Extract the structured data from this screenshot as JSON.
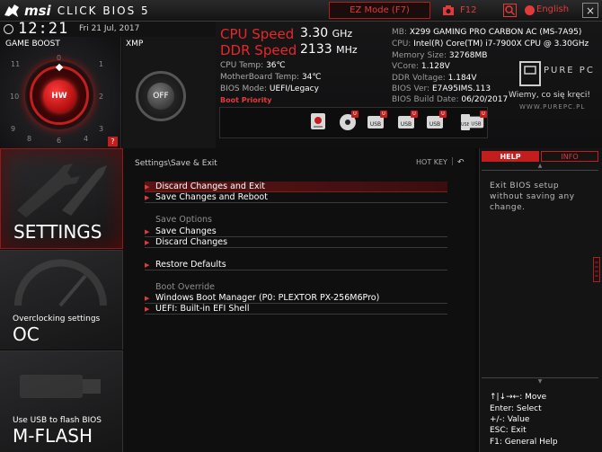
{
  "header": {
    "logo_brand": "msi",
    "logo_product": "CLICK BIOS 5",
    "ez_mode": "EZ Mode (F7)",
    "f12": "F12",
    "language": "English",
    "close": "×"
  },
  "clock": {
    "time": "12:21",
    "date": "Fri 21 Jul, 2017"
  },
  "game_boost": {
    "label": "GAME BOOST",
    "knob_label": "HW",
    "help_badge": "?",
    "dial_numbers": [
      "11",
      "0",
      "1",
      "10",
      "2",
      "9",
      "3",
      "8",
      "4",
      "6"
    ]
  },
  "xmp": {
    "label": "XMP",
    "state": "OFF"
  },
  "speeds": {
    "cpu_label": "CPU Speed",
    "cpu_value": "3.30",
    "cpu_unit": "GHz",
    "ddr_label": "DDR Speed",
    "ddr_value": "2133",
    "ddr_unit": "MHz"
  },
  "monitor": {
    "cpu_temp_label": "CPU Temp:",
    "cpu_temp": "36℃",
    "mb_temp_label": "MotherBoard Temp:",
    "mb_temp": "34℃",
    "bios_mode_label": "BIOS Mode:",
    "bios_mode": "UEFI/Legacy"
  },
  "boot_priority": {
    "label": "Boot Priority",
    "devices": [
      {
        "icon": "hdd-icon",
        "badge": ""
      },
      {
        "icon": "optical-disc-icon",
        "badge": "U"
      },
      {
        "icon": "usb-drive-icon",
        "badge": "U",
        "text": "USB"
      },
      {
        "icon": "usb-drive-icon",
        "badge": "U",
        "text": "USB"
      },
      {
        "icon": "usb-drive-icon",
        "badge": "U",
        "text": "USB"
      },
      {
        "icon": "usb-key-icon",
        "badge": "",
        "text": "USB"
      },
      {
        "icon": "usb-drive-icon",
        "badge": "U",
        "text": "USB"
      },
      {
        "icon": "network-icon",
        "badge": "U"
      }
    ]
  },
  "system": {
    "mb_label": "MB:",
    "mb": "X299 GAMING PRO CARBON AC (MS-7A95)",
    "cpu_label": "CPU:",
    "cpu": "Intel(R) Core(TM) i7-7900X CPU @ 3.30GHz",
    "mem_label": "Memory Size:",
    "mem": "32768MB",
    "vcore_label": "VCore:",
    "vcore": "1.128V",
    "ddr_v_label": "DDR Voltage:",
    "ddr_v": "1.184V",
    "bios_ver_label": "BIOS Ver:",
    "bios_ver": "E7A95IMS.113",
    "bios_date_label": "BIOS Build Date:",
    "bios_date": "06/20/2017"
  },
  "watermark": {
    "brand": "PURE PC",
    "motto": "Wiemy, co się kręci!",
    "url": "WWW.PUREPC.PL"
  },
  "nav": {
    "settings": {
      "title": "SETTINGS"
    },
    "oc": {
      "subtitle": "Overclocking settings",
      "title": "OC"
    },
    "mflash": {
      "subtitle": "Use USB to flash BIOS",
      "title": "M-FLASH"
    }
  },
  "main": {
    "breadcrumb": "Settings\\Save & Exit",
    "hotkey": "HOT KEY",
    "hotkey_sep": "|",
    "back": "↶",
    "items": [
      {
        "label": "Discard Changes and Exit"
      },
      {
        "label": "Save Changes and Reboot"
      }
    ],
    "save_heading": "Save Options",
    "save_items": [
      {
        "label": "Save Changes"
      },
      {
        "label": "Discard Changes"
      }
    ],
    "restore": "Restore Defaults",
    "boot_heading": "Boot Override",
    "boot_items": [
      {
        "label": "Windows Boot Manager (P0: PLEXTOR PX-256M6Pro)"
      },
      {
        "label": "UEFI: Built-in EFI Shell"
      }
    ]
  },
  "help": {
    "tab_help": "HELP",
    "tab_info": "INFO",
    "text": "Exit BIOS setup without saving any change.",
    "keys": [
      "↑|↓→←: Move",
      "Enter: Select",
      "+/-: Value",
      "ESC: Exit",
      "F1: General Help"
    ]
  },
  "colors": {
    "accent": "#e8272a",
    "accent_dark": "#c21e1e",
    "background": "#0b0b0c"
  }
}
